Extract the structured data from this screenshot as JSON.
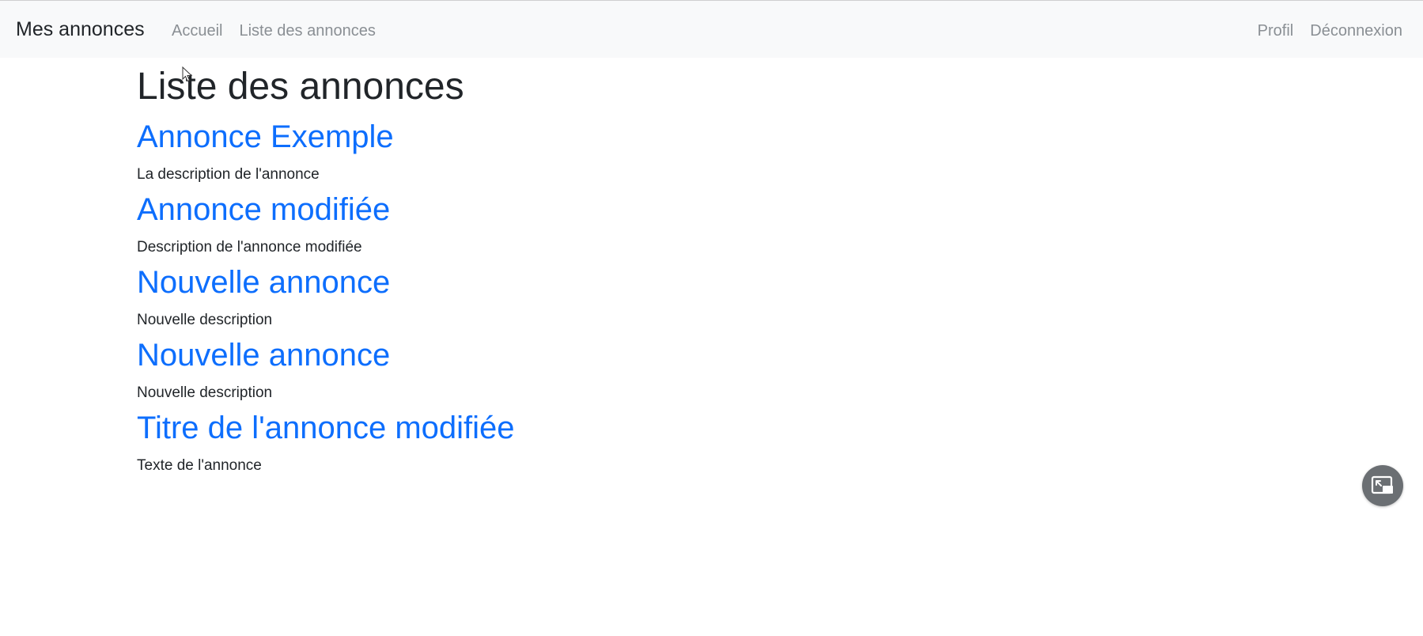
{
  "navbar": {
    "brand": "Mes annonces",
    "left_links": [
      {
        "label": "Accueil"
      },
      {
        "label": "Liste des annonces"
      }
    ],
    "right_links": [
      {
        "label": "Profil"
      },
      {
        "label": "Déconnexion"
      }
    ]
  },
  "main": {
    "title": "Liste des annonces",
    "ads": [
      {
        "title": "Annonce Exemple",
        "description": "La description de l'annonce"
      },
      {
        "title": "Annonce modifiée",
        "description": "Description de l'annonce modifiée"
      },
      {
        "title": "Nouvelle annonce",
        "description": "Nouvelle description"
      },
      {
        "title": "Nouvelle annonce",
        "description": "Nouvelle description"
      },
      {
        "title": "Titre de l'annonce modifiée",
        "description": "Texte de l'annonce"
      }
    ]
  },
  "icons": {
    "cursor": "mouse-pointer-icon",
    "pip": "picture-in-picture-icon"
  },
  "colors": {
    "link": "#0d6efd",
    "navbar_bg": "#f8f9fa",
    "nav_link": "#8a8f94"
  }
}
